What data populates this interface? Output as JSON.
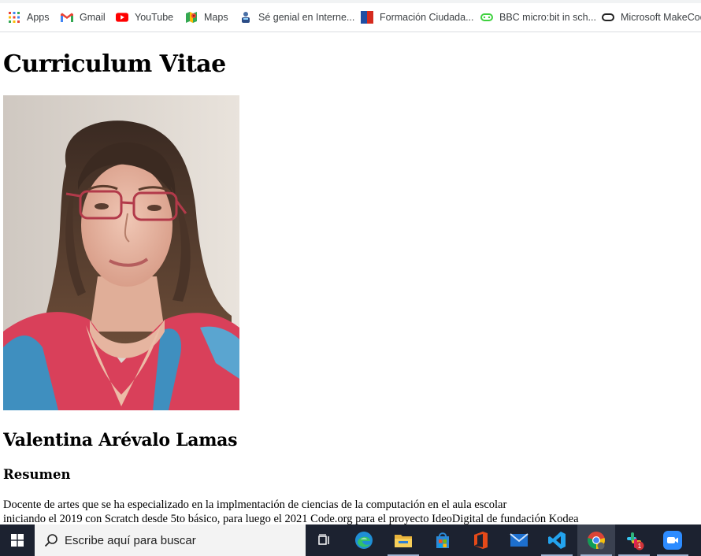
{
  "bookmarks": [
    {
      "label": "Apps",
      "icon": "apps-grid-icon"
    },
    {
      "label": "Gmail",
      "icon": "gmail-icon"
    },
    {
      "label": "YouTube",
      "icon": "youtube-icon"
    },
    {
      "label": "Maps",
      "icon": "maps-icon"
    },
    {
      "label": "Sé genial en Interne...",
      "icon": "be-internet-awesome-icon"
    },
    {
      "label": "Formación Ciudada...",
      "icon": "chile-flag-icon"
    },
    {
      "label": "BBC micro:bit in sch...",
      "icon": "microbit-icon"
    },
    {
      "label": "Microsoft MakeCode",
      "icon": "makecode-icon"
    }
  ],
  "page": {
    "title": "Curriculum Vitae",
    "photo_alt": "Foto de perfil",
    "name": "Valentina Arévalo Lamas",
    "section": "Resumen",
    "summary_lines": [
      "Docente de artes que se ha especializado en la implmentación de ciencias de la computación en el aula escolar",
      "iniciando el 2019 con Scratch desde 5to básico, para luego el 2021 Code.org para el proyecto IdeoDigital de fundación Kodea"
    ]
  },
  "taskbar": {
    "search_placeholder": "Escribe aquí para buscar",
    "apps": [
      "task-view-icon",
      "edge-icon",
      "file-explorer-icon",
      "microsoft-store-icon",
      "office-icon",
      "mail-icon",
      "vscode-icon",
      "chrome-icon",
      "slack-icon",
      "zoom-icon"
    ],
    "slack_badge": "1"
  }
}
